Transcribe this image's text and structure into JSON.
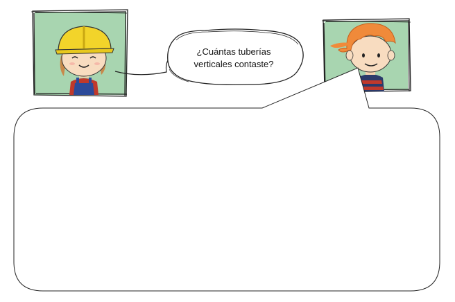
{
  "speech_bubble": {
    "line1": "¿Cuántas tuberías",
    "line2": "verticales contaste?"
  },
  "characters": {
    "left": {
      "name": "worker-girl",
      "helmet_color": "#f2d42a",
      "frame_bg": "#a8d5b0"
    },
    "right": {
      "name": "boy",
      "hair_color": "#f08a3a",
      "frame_bg": "#a8d5b0"
    }
  },
  "answer_box": {
    "text": ""
  }
}
